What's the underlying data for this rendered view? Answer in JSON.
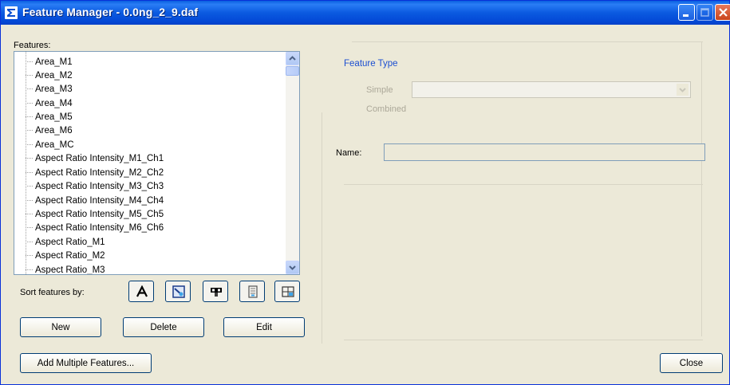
{
  "window": {
    "title": "Feature Manager - 0.0ng_2_9.daf",
    "app_icon": "sigma-icon",
    "controls": [
      "minimize-icon",
      "maximize-icon",
      "close-icon"
    ]
  },
  "features_panel": {
    "label": "Features:",
    "items": [
      "Area_M1",
      "Area_M2",
      "Area_M3",
      "Area_M4",
      "Area_M5",
      "Area_M6",
      "Area_MC",
      "Aspect Ratio Intensity_M1_Ch1",
      "Aspect Ratio Intensity_M2_Ch2",
      "Aspect Ratio Intensity_M3_Ch3",
      "Aspect Ratio Intensity_M4_Ch4",
      "Aspect Ratio Intensity_M5_Ch5",
      "Aspect Ratio Intensity_M6_Ch6",
      "Aspect Ratio_M1",
      "Aspect Ratio_M2",
      "Aspect Ratio_M3"
    ]
  },
  "sort": {
    "label": "Sort features by:",
    "buttons": [
      {
        "name": "sort-alpha-button",
        "icon": "letter-a-icon"
      },
      {
        "name": "sort-type-button",
        "icon": "feature-type-icon"
      },
      {
        "name": "sort-mask-button",
        "icon": "mask-icon"
      },
      {
        "name": "sort-channel-button",
        "icon": "channel-icon"
      },
      {
        "name": "sort-combined-button",
        "icon": "combined-icon"
      }
    ]
  },
  "buttons": {
    "new": "New",
    "delete": "Delete",
    "edit": "Edit",
    "add_multiple": "Add Multiple Features...",
    "close": "Close"
  },
  "feature_type": {
    "heading": "Feature Type",
    "simple_label": "Simple",
    "combined_label": "Combined",
    "simple_value": ""
  },
  "name_field": {
    "label": "Name:",
    "value": ""
  },
  "colors": {
    "titlebar": "#0a5fe0",
    "dialog_bg": "#ece9d8",
    "heading_blue": "#1c4fd1",
    "disabled_text": "#aca899"
  }
}
